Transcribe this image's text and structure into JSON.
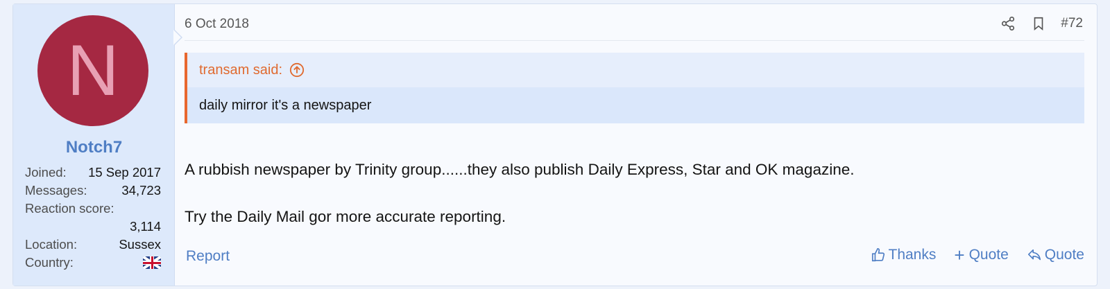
{
  "user": {
    "avatar_letter": "N",
    "avatar_color": "#a52842",
    "name": "Notch7",
    "stats": [
      {
        "label": "Joined:",
        "value": "15 Sep 2017"
      },
      {
        "label": "Messages:",
        "value": "34,723"
      },
      {
        "label": "Reaction score:",
        "value": "3,114"
      },
      {
        "label": "Location:",
        "value": "Sussex"
      },
      {
        "label": "Country:",
        "value": ""
      }
    ],
    "country_flag_icon": "uk-flag-icon"
  },
  "post": {
    "date": "6 Oct 2018",
    "number": "#72",
    "icons": {
      "share": "share-icon",
      "bookmark": "bookmark-icon"
    },
    "quote": {
      "author_line": "transam said:",
      "text": "daily mirror it's a newspaper",
      "accent": "#e8672e"
    },
    "message": [
      "A rubbish newspaper by Trinity group......they also publish Daily Express, Star and OK magazine.",
      "Try the Daily Mail gor more accurate reporting."
    ],
    "footer": {
      "report": "Report",
      "thanks": "Thanks",
      "multi_quote": "Quote",
      "quote": "Quote"
    },
    "link_color": "#4f7ec4"
  }
}
